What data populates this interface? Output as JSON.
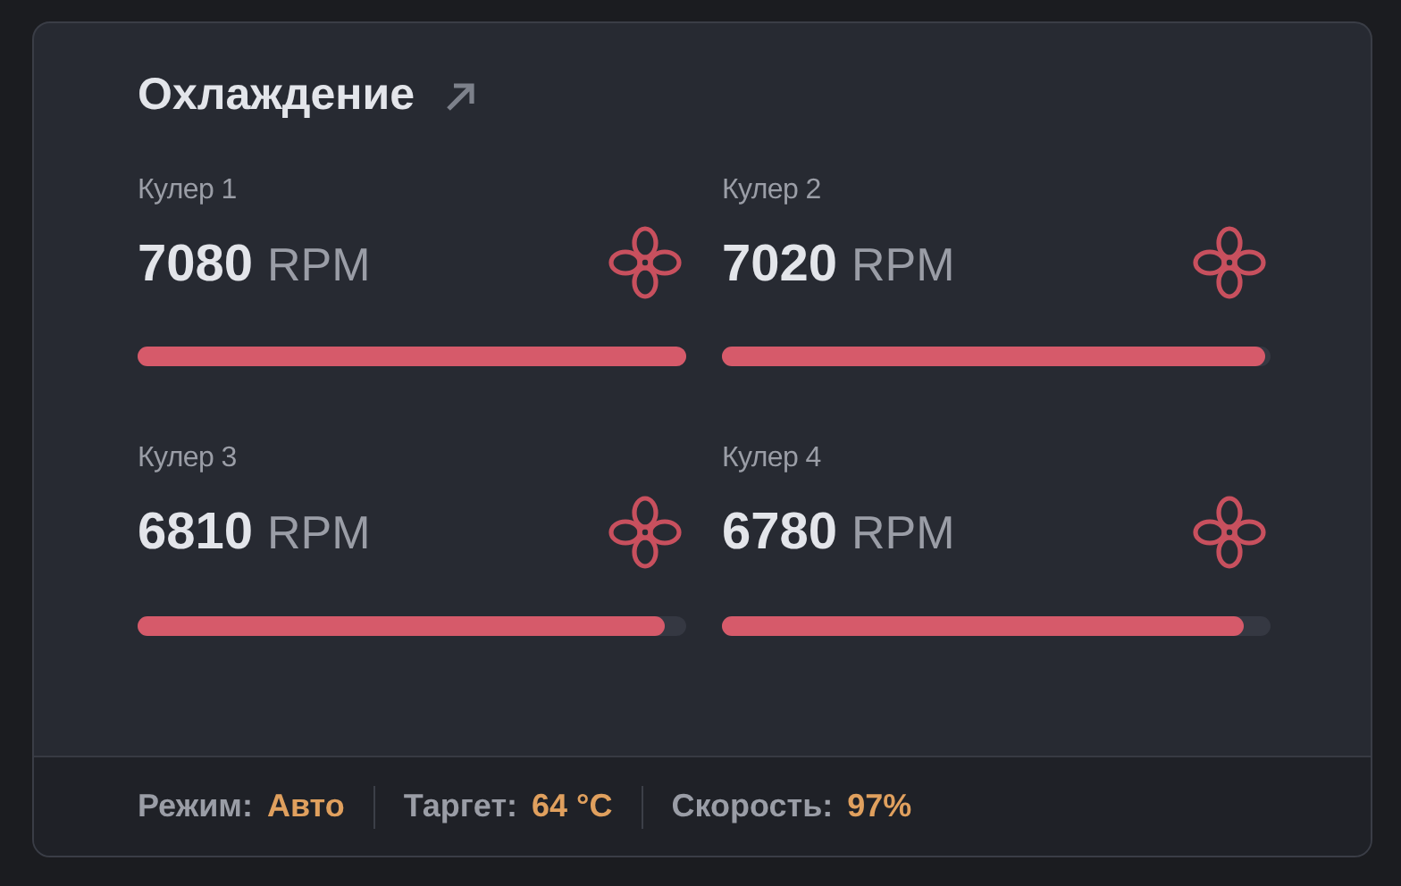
{
  "title": "Охлаждение",
  "coolers": [
    {
      "label": "Кулер 1",
      "value": "7080",
      "unit": "RPM",
      "level": 1.0
    },
    {
      "label": "Кулер 2",
      "value": "7020",
      "unit": "RPM",
      "level": 0.99
    },
    {
      "label": "Кулер 3",
      "value": "6810",
      "unit": "RPM",
      "level": 0.96
    },
    {
      "label": "Кулер 4",
      "value": "6780",
      "unit": "RPM",
      "level": 0.95
    }
  ],
  "footer": [
    {
      "label": "Режим:",
      "value": "Авто"
    },
    {
      "label": "Таргет:",
      "value": "64 °C"
    },
    {
      "label": "Скорость:",
      "value": "97%"
    }
  ]
}
